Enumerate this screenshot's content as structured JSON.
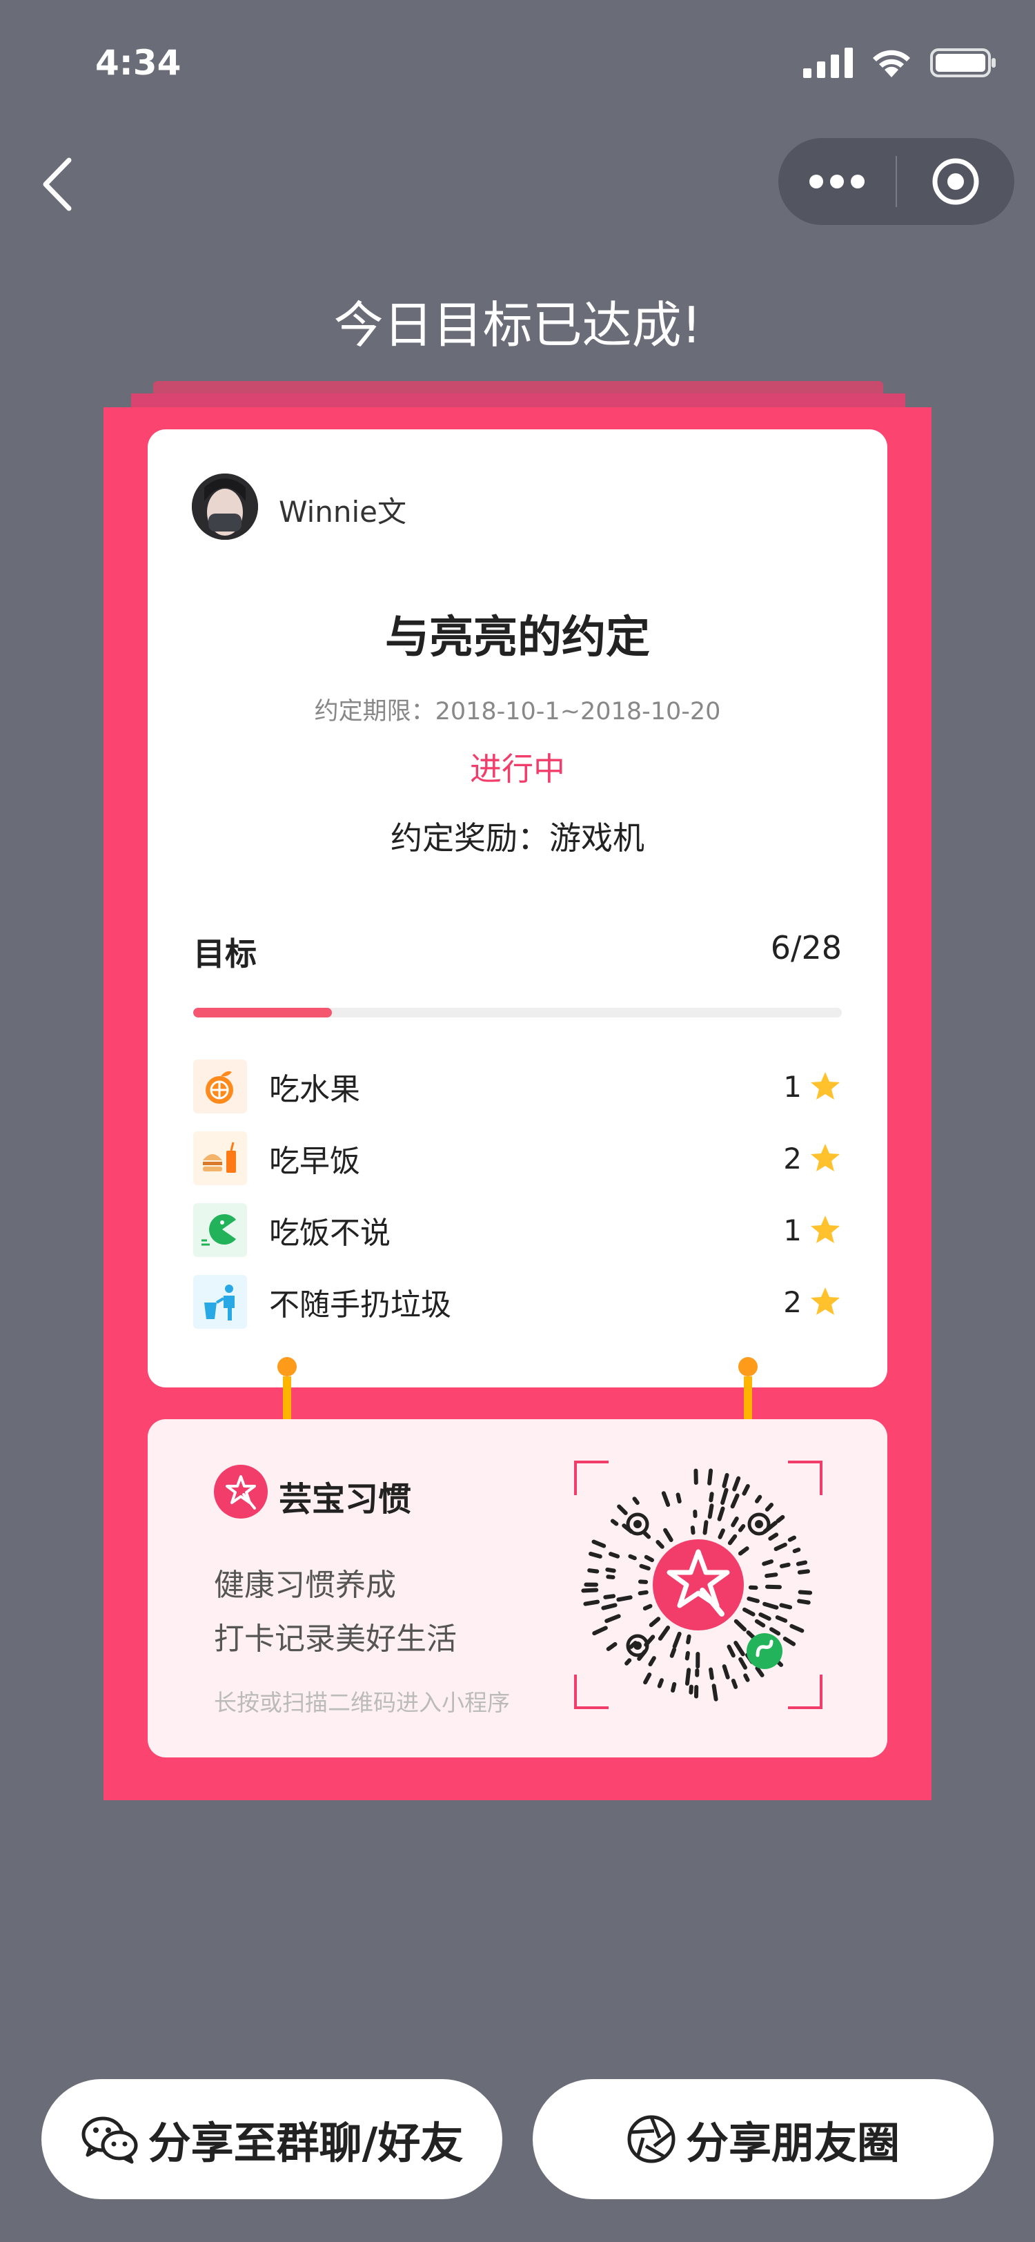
{
  "status_bar": {
    "time": "4:34"
  },
  "nav": {
    "back_icon": "chevron-left-icon",
    "more_icon": "more-dots-icon",
    "close_icon": "target-close-icon"
  },
  "headline": "今日目标已达成!",
  "card": {
    "username": "Winnie文",
    "title": "与亮亮的约定",
    "period": "约定期限：2018-10-1~2018-10-20",
    "status": "进行中",
    "reward": "约定奖励：游戏机",
    "goal_label": "目标",
    "goal_count": "6/28",
    "progress_fraction": 0.2143,
    "goals": [
      {
        "name": "吃水果",
        "stars": "1",
        "icon": "fruit-icon",
        "icon_bg": "#fff1e6"
      },
      {
        "name": "吃早饭",
        "stars": "2",
        "icon": "breakfast-icon",
        "icon_bg": "#fff4e6"
      },
      {
        "name": "吃饭不说",
        "stars": "1",
        "icon": "pacman-icon",
        "icon_bg": "#e9f8ef"
      },
      {
        "name": "不随手扔垃圾",
        "stars": "2",
        "icon": "trash-icon",
        "icon_bg": "#e8f6fd"
      }
    ]
  },
  "mini_program": {
    "name": "芸宝习惯",
    "slogan_line1": "健康习惯养成",
    "slogan_line2": "打卡记录美好生活",
    "hint": "长按或扫描二维码进入小程序"
  },
  "buttons": {
    "share_group": "分享至群聊/好友",
    "share_moments": "分享朋友圈"
  },
  "colors": {
    "accent": "#fc4470",
    "background": "#6a6d78",
    "progress": "#f4566f",
    "star": "#ffc22c"
  }
}
